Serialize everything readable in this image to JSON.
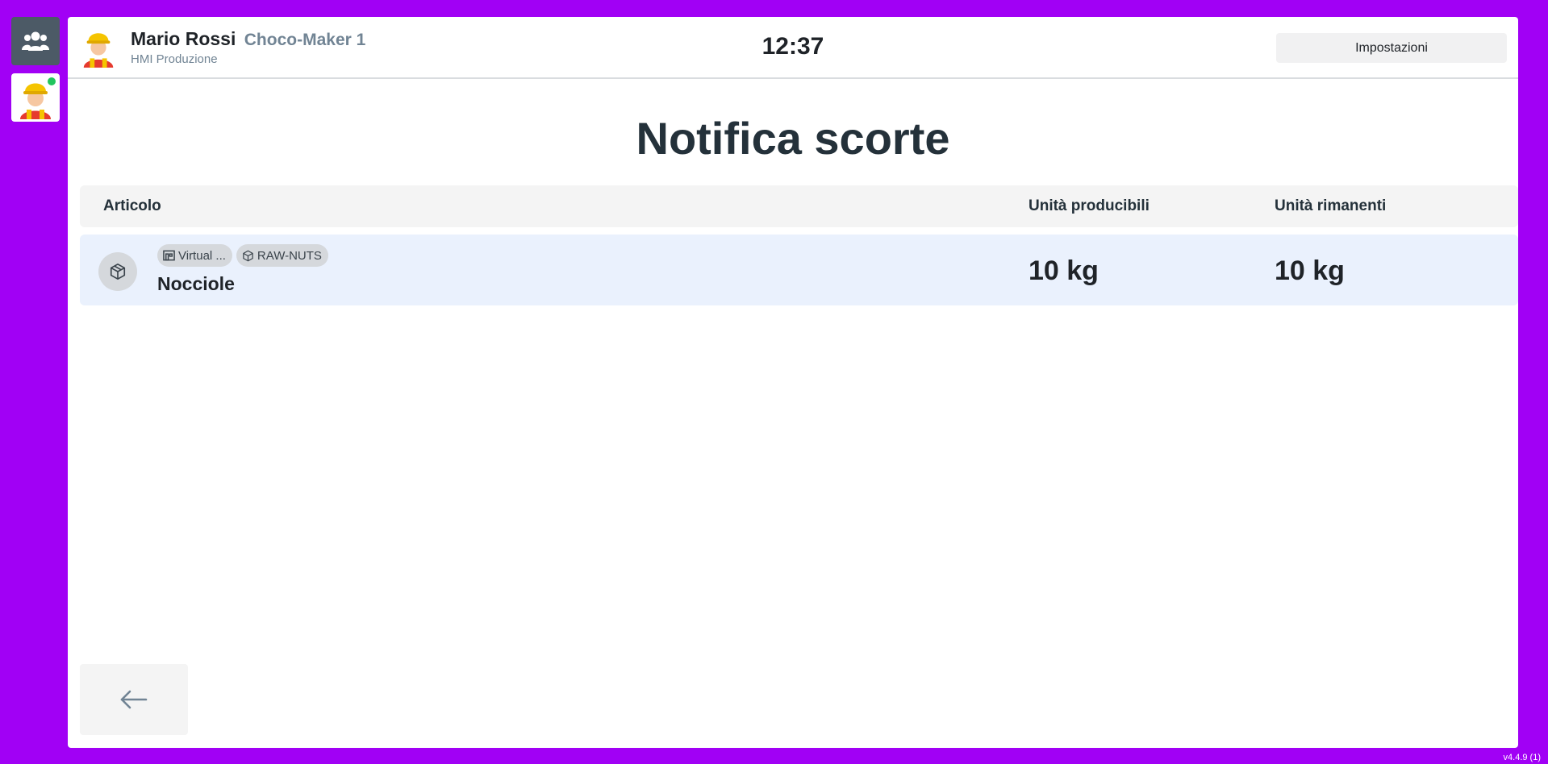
{
  "sidebar": {
    "team_icon": "users-icon",
    "user_icon": "worker-avatar-icon",
    "status_color": "#22c55e"
  },
  "header": {
    "user_name": "Mario Rossi",
    "machine_name": "Choco-Maker 1",
    "subtitle": "HMI Produzione",
    "clock": "12:37",
    "settings_label": "Impostazioni"
  },
  "page": {
    "title": "Notifica scorte"
  },
  "table": {
    "columns": [
      "Articolo",
      "Unità producibili",
      "Unità rimanenti"
    ],
    "rows": [
      {
        "icon": "package-icon",
        "tags": [
          {
            "icon": "warehouse-icon",
            "label": "Virtual ..."
          },
          {
            "icon": "package-icon",
            "label": "RAW-NUTS"
          }
        ],
        "name": "Nocciole",
        "producible": "10 kg",
        "remaining": "10 kg"
      }
    ]
  },
  "footer": {
    "back_icon": "arrow-left-icon",
    "version": "v4.4.9 (1)"
  },
  "colors": {
    "background": "#a100f5",
    "panel": "#ffffff",
    "row_highlight": "#eaf1fd",
    "header_row": "#f4f4f4",
    "text_dark": "#24313a",
    "text_muted": "#718494"
  }
}
